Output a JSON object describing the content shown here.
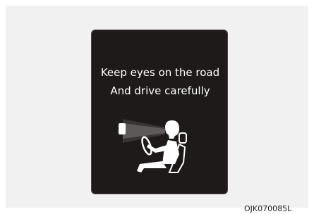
{
  "display": {
    "line1": "Keep eyes on the road",
    "line2": "And drive carefully",
    "icon": "driver-attention-icon"
  },
  "figure_code": "OJK070085L",
  "colors": {
    "page_background": "#ffffff",
    "frame_background": "#f1f1f1",
    "display_background": "#1f1a1a",
    "display_text": "#ffffff"
  }
}
